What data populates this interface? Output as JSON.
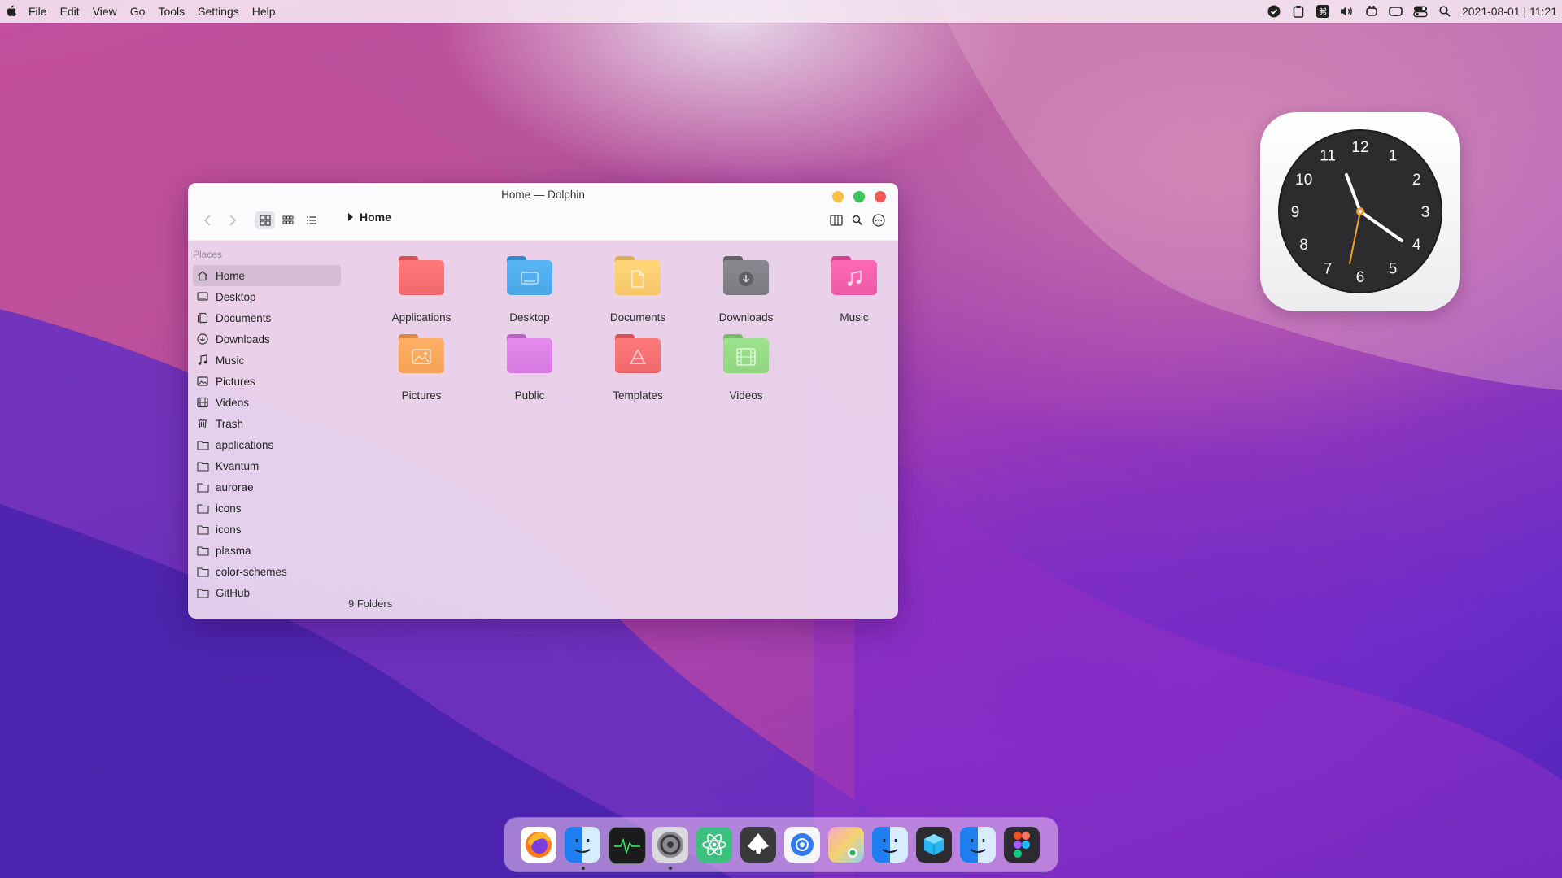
{
  "menubar": {
    "menus": [
      "File",
      "Edit",
      "View",
      "Go",
      "Tools",
      "Settings",
      "Help"
    ],
    "datetime": "2021-08-01 | 11:21",
    "tray_icons": [
      "check-circle-icon",
      "clipboard-icon",
      "command-icon",
      "volume-icon",
      "plug-icon",
      "battery-icon",
      "toggle-icon",
      "search-icon"
    ]
  },
  "window": {
    "title": "Home — Dolphin",
    "breadcrumb": "Home",
    "places_header": "Places",
    "places": [
      {
        "label": "Home",
        "icon": "home-icon",
        "active": true
      },
      {
        "label": "Desktop",
        "icon": "desktop-icon"
      },
      {
        "label": "Documents",
        "icon": "documents-icon"
      },
      {
        "label": "Downloads",
        "icon": "download-icon"
      },
      {
        "label": "Music",
        "icon": "music-icon"
      },
      {
        "label": "Pictures",
        "icon": "image-icon"
      },
      {
        "label": "Videos",
        "icon": "film-icon"
      },
      {
        "label": "Trash",
        "icon": "trash-icon"
      },
      {
        "label": "applications",
        "icon": "folder-icon"
      },
      {
        "label": "Kvantum",
        "icon": "folder-icon"
      },
      {
        "label": "aurorae",
        "icon": "folder-icon"
      },
      {
        "label": "icons",
        "icon": "folder-icon"
      },
      {
        "label": "icons",
        "icon": "folder-icon"
      },
      {
        "label": "plasma",
        "icon": "folder-icon"
      },
      {
        "label": "color-schemes",
        "icon": "folder-icon"
      },
      {
        "label": "GitHub",
        "icon": "folder-icon"
      }
    ],
    "folders": [
      {
        "label": "Applications",
        "color": "#f0696c",
        "glyph": "none"
      },
      {
        "label": "Desktop",
        "color": "#4aa6e6",
        "glyph": "desktop"
      },
      {
        "label": "Documents",
        "color": "#f5c76a",
        "glyph": "document"
      },
      {
        "label": "Downloads",
        "color": "#7a7a80",
        "glyph": "download"
      },
      {
        "label": "Music",
        "color": "#ee5aa6",
        "glyph": "music"
      },
      {
        "label": "Pictures",
        "color": "#f5a155",
        "glyph": "image"
      },
      {
        "label": "Public",
        "color": "#d57be0",
        "glyph": "none"
      },
      {
        "label": "Templates",
        "color": "#f0696c",
        "glyph": "templates"
      },
      {
        "label": "Videos",
        "color": "#8fd47e",
        "glyph": "film"
      }
    ],
    "status": "9 Folders"
  },
  "clock": {
    "numbers": [
      "12",
      "1",
      "2",
      "3",
      "4",
      "5",
      "6",
      "7",
      "8",
      "9",
      "10",
      "11"
    ]
  },
  "dock": {
    "apps": [
      "firefox-icon",
      "finder-icon",
      "activity-monitor-icon",
      "system-preferences-icon",
      "atom-icon",
      "inkscape-icon",
      "mail-icon",
      "photos-icon",
      "finder-icon",
      "box-icon",
      "finder-icon",
      "figma-icon"
    ]
  },
  "colors": {
    "accent": "#b83aa6",
    "close": "#f25a56",
    "minimize": "#f5c043",
    "maximize": "#3ac45a"
  }
}
